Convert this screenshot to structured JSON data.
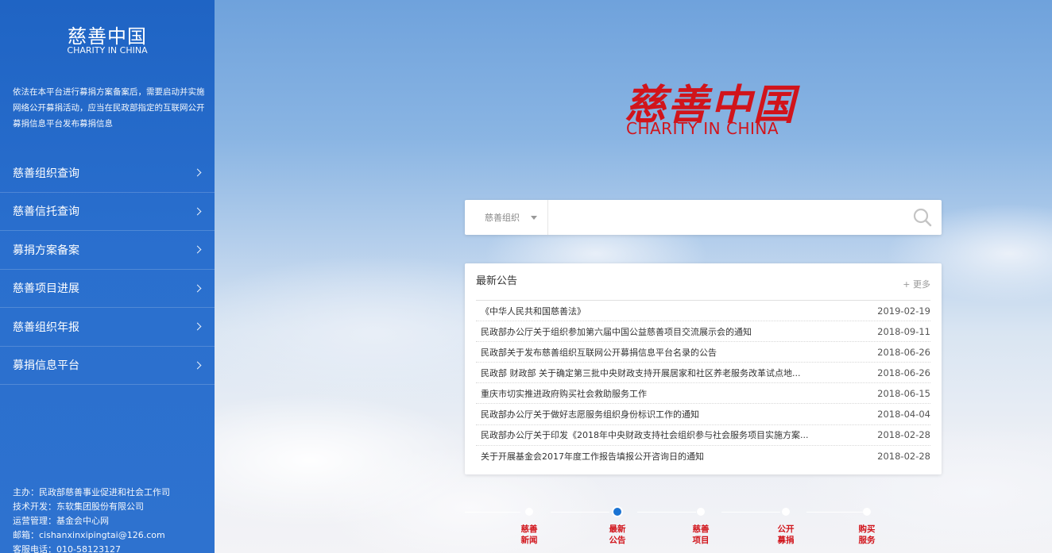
{
  "sidebar": {
    "brand_title": "慈善中国",
    "brand_subtitle": "CHARITY IN CHINA",
    "intro": "依法在本平台进行募捐方案备案后，需要启动并实施网络公开募捐活动，应当在民政部指定的互联网公开募捐信息平台发布募捐信息",
    "nav": [
      {
        "label": "慈善组织查询"
      },
      {
        "label": "慈善信托查询"
      },
      {
        "label": "募捐方案备案"
      },
      {
        "label": "慈善项目进展"
      },
      {
        "label": "慈善组织年报"
      },
      {
        "label": "募捐信息平台"
      }
    ],
    "footer": {
      "host": "主办：民政部慈善事业促进和社会工作司",
      "tech": "技术开发：东软集团股份有限公司",
      "ops": "运营管理：基金会中心网",
      "email": "邮箱：cishanxinxipingtai@126.com",
      "phone": "客服电话：010-58123127"
    }
  },
  "logo": {
    "chinese": "慈善中国",
    "english": "CHARITY IN CHINA",
    "color": "#d1141b"
  },
  "search": {
    "category": "慈善组织",
    "value": "",
    "placeholder": ""
  },
  "notices": {
    "title": "最新公告",
    "more": "+ 更多",
    "items": [
      {
        "text": "《中华人民共和国慈善法》",
        "date": "2019-02-19"
      },
      {
        "text": "民政部办公厅关于组织参加第六届中国公益慈善项目交流展示会的通知",
        "date": "2018-09-11"
      },
      {
        "text": "民政部关于发布慈善组织互联网公开募捐信息平台名录的公告",
        "date": "2018-06-26"
      },
      {
        "text": "民政部 财政部 关于确定第三批中央财政支持开展居家和社区养老服务改革试点地...",
        "date": "2018-06-26"
      },
      {
        "text": "重庆市切实推进政府购买社会救助服务工作",
        "date": "2018-06-15"
      },
      {
        "text": "民政部办公厅关于做好志愿服务组织身份标识工作的通知",
        "date": "2018-04-04"
      },
      {
        "text": "民政部办公厅关于印发《2018年中央财政支持社会组织参与社会服务项目实施方案...",
        "date": "2018-02-28"
      },
      {
        "text": "关于开展基金会2017年度工作报告填报公开咨询日的通知",
        "date": "2018-02-28"
      }
    ]
  },
  "timeline": {
    "items": [
      {
        "line1": "慈善",
        "line2": "新闻",
        "active": false
      },
      {
        "line1": "最新",
        "line2": "公告",
        "active": true
      },
      {
        "line1": "慈善",
        "line2": "项目",
        "active": false
      },
      {
        "line1": "公开",
        "line2": "募捐",
        "active": false
      },
      {
        "line1": "购买",
        "line2": "服务",
        "active": false
      }
    ]
  },
  "colors": {
    "sidebar_blue": "#2a6fce",
    "accent_red": "#d1141b",
    "active_dot": "#1a73d3"
  }
}
